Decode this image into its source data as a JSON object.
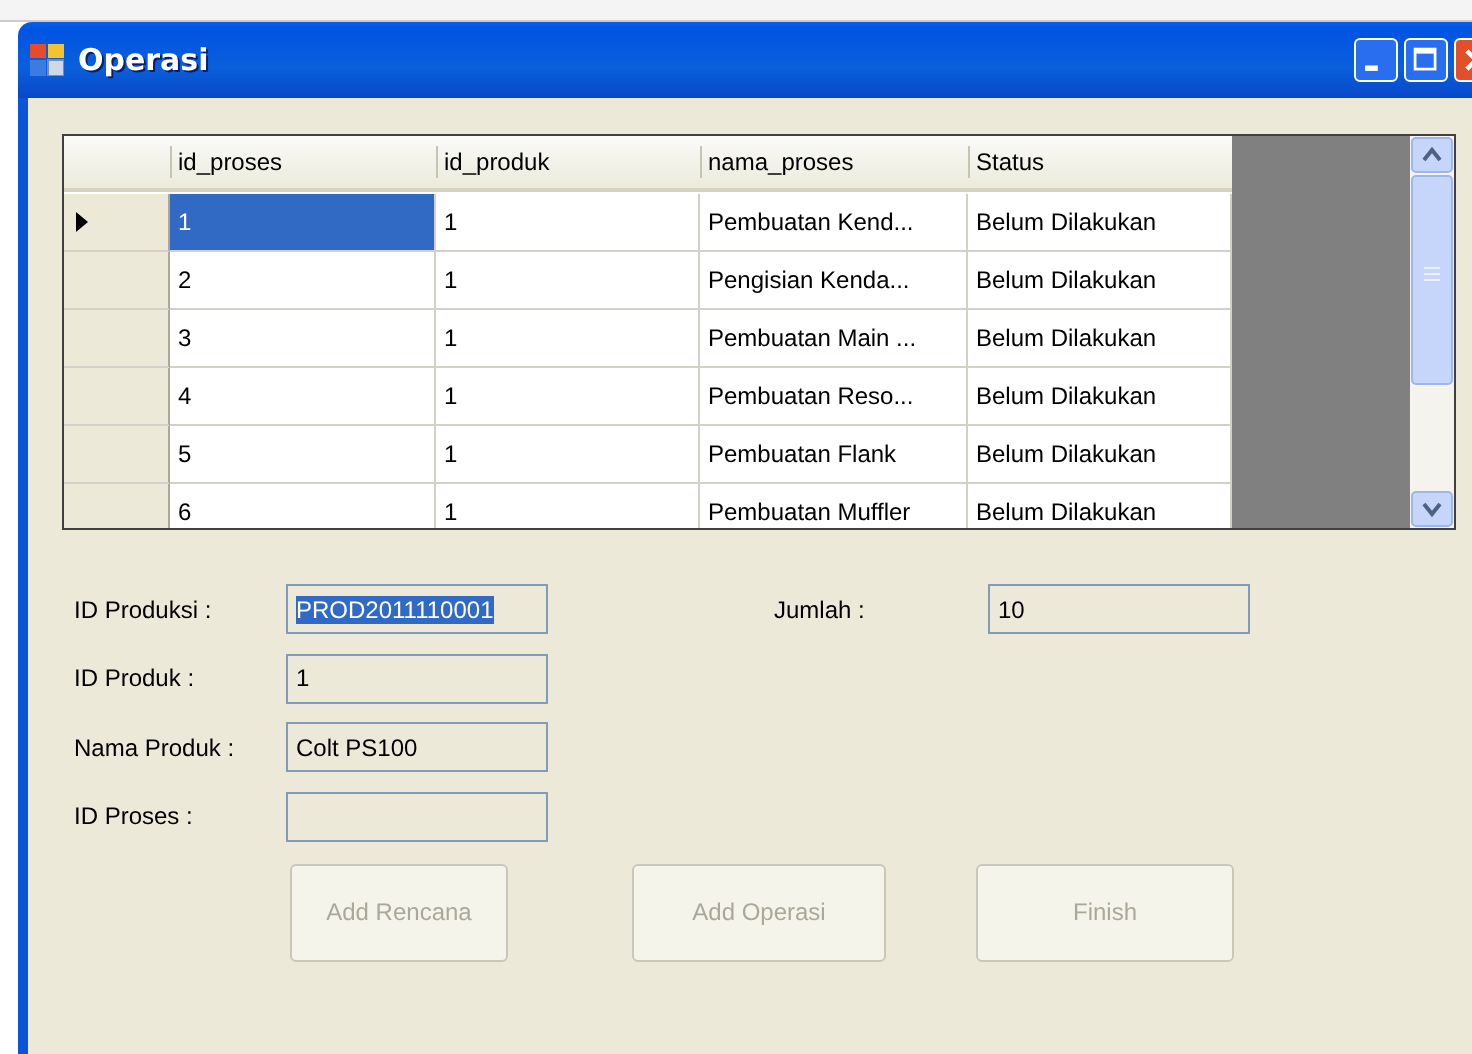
{
  "window": {
    "title": "Operasi"
  },
  "grid": {
    "columns": [
      "id_proses",
      "id_produk",
      "nama_proses",
      "Status"
    ],
    "rows": [
      {
        "selected": true,
        "cells": [
          "1",
          "1",
          "Pembuatan Kend...",
          "Belum Dilakukan"
        ]
      },
      {
        "selected": false,
        "cells": [
          "2",
          "1",
          "Pengisian Kenda...",
          "Belum Dilakukan"
        ]
      },
      {
        "selected": false,
        "cells": [
          "3",
          "1",
          "Pembuatan Main ...",
          "Belum Dilakukan"
        ]
      },
      {
        "selected": false,
        "cells": [
          "4",
          "1",
          "Pembuatan Reso...",
          "Belum Dilakukan"
        ]
      },
      {
        "selected": false,
        "cells": [
          "5",
          "1",
          "Pembuatan Flank",
          "Belum Dilakukan"
        ]
      },
      {
        "selected": false,
        "cells": [
          "6",
          "1",
          "Pembuatan Muffler",
          "Belum Dilakukan"
        ]
      }
    ]
  },
  "form": {
    "left_fields": [
      {
        "label": "ID Produksi :",
        "value": "PROD2011110001",
        "text_selected": true
      },
      {
        "label": "ID Produk :",
        "value": "1",
        "text_selected": false
      },
      {
        "label": "Nama Produk :",
        "value": "Colt PS100",
        "text_selected": false
      },
      {
        "label": "ID Proses :"
      }
    ],
    "right_fields": [
      {
        "label": "Jumlah :",
        "value": "10",
        "text_selected": false
      }
    ]
  },
  "buttons": [
    {
      "label": "Add Rencana",
      "disabled": true
    },
    {
      "label": "Add Operasi",
      "disabled": true
    },
    {
      "label": "Finish",
      "disabled": true
    }
  ]
}
